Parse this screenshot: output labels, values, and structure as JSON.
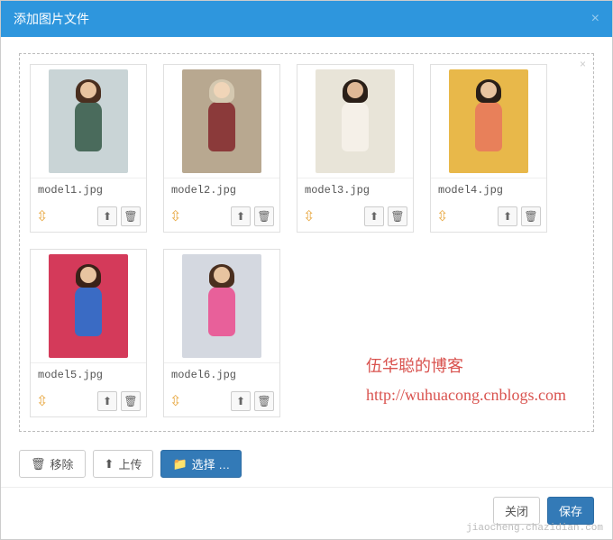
{
  "header": {
    "title": "添加图片文件",
    "close": "×"
  },
  "dropzone": {
    "close": "×"
  },
  "thumbs": [
    {
      "name": "model1.jpg",
      "bg": "#c9d4d6",
      "skin": "#e8c4a0",
      "hair": "#4a2f1f",
      "outfit": "#4a6b5c"
    },
    {
      "name": "model2.jpg",
      "bg": "#b8a890",
      "skin": "#f0d5b8",
      "hair": "#d4c8b0",
      "outfit": "#8b3a3a"
    },
    {
      "name": "model3.jpg",
      "bg": "#e8e4d8",
      "skin": "#dfb896",
      "hair": "#2a1f18",
      "outfit": "#f5f0e8"
    },
    {
      "name": "model4.jpg",
      "bg": "#e8b84a",
      "skin": "#e8c4a0",
      "hair": "#2a1f18",
      "outfit": "#e8805a"
    },
    {
      "name": "model5.jpg",
      "bg": "#d43a5a",
      "skin": "#e8c4a0",
      "hair": "#3a2218",
      "outfit": "#3a6bc4"
    },
    {
      "name": "model6.jpg",
      "bg": "#d4d8e0",
      "skin": "#e8c4a0",
      "hair": "#4a2f1f",
      "outfit": "#e8609a"
    }
  ],
  "blog": {
    "title": "伍华聪的博客",
    "url": "http://wuhuacong.cnblogs.com"
  },
  "toolbar": {
    "remove": "移除",
    "upload": "上传",
    "select": "选择 …"
  },
  "footer": {
    "close": "关闭",
    "save": "保存"
  },
  "icons": {
    "trash": "🗑",
    "upload_arrow": "⬆",
    "folder": "📁",
    "drag": "⇳"
  },
  "watermark": "jiaocheng.chazidian.com"
}
